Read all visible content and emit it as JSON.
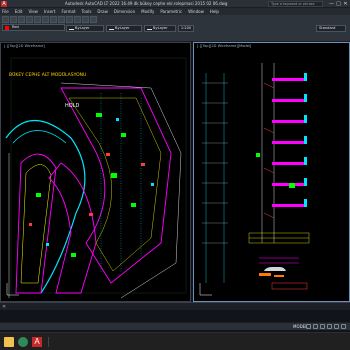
{
  "window": {
    "title": "Autodesk AutoCAD LT 2022    16.49 dk bükey cephe ekr.rolepmasi 2015 02 06.dwg",
    "search_placeholder": "Type a keyword or phrase",
    "app_logo": "A",
    "controls": [
      "—",
      "□",
      "✕"
    ]
  },
  "menu": {
    "items": [
      "File",
      "Edit",
      "View",
      "Insert",
      "Format",
      "Tools",
      "Draw",
      "Dimension",
      "Modify",
      "Parametric",
      "Window",
      "Help"
    ]
  },
  "toolbar": {
    "layer": "Red",
    "layer_color": "#ff0000",
    "color_combo": "ByLayer",
    "linetype_combo": "ByLayer",
    "lineweight_combo": "ByLayer",
    "scale": "1:200",
    "text_style": "Standard"
  },
  "viewports": {
    "left": {
      "label": "[-][Top][2D Wireframe]",
      "annotation_top": "BÜKEY CEPHE ALT MODÜLASYONU",
      "annotation_hold": "HOLD"
    },
    "right": {
      "label": "[-][Top][2D Wireframe][Model]"
    }
  },
  "commandline": {
    "close_glyph": "✕"
  },
  "statusbar": {
    "mode": "MODEL"
  },
  "taskbar": {
    "autocad_label": "A"
  }
}
